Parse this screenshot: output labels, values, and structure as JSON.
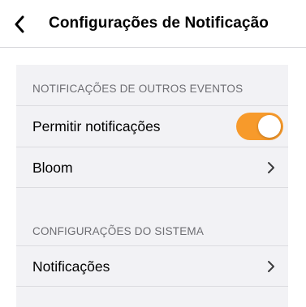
{
  "nav": {
    "back_icon": "chevron-left-icon",
    "title": "Configurações de Notificação"
  },
  "sections": {
    "other_events": {
      "header": "NOTIFICAÇÕES DE OUTROS EVENTOS",
      "allow_notifications": {
        "label": "Permitir notificações",
        "enabled": true
      },
      "bloom": {
        "label": "Bloom",
        "icon": "chevron-right-icon"
      }
    },
    "system": {
      "header": "CONFIGURAÇÕES DO SISTEMA",
      "notifications": {
        "label": "Notificações",
        "icon": "chevron-right-icon"
      }
    }
  },
  "colors": {
    "accent": "#f79a2b",
    "group_background": "#f2f2f5",
    "section_header": "#6d6d72"
  }
}
